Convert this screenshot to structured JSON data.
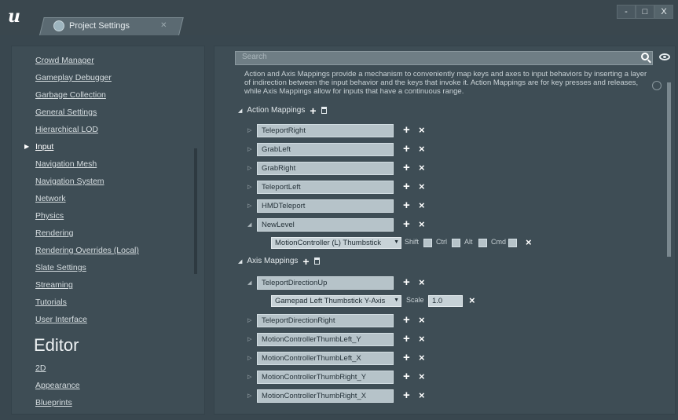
{
  "window": {
    "tab_title": "Project Settings",
    "controls": {
      "minimize": "-",
      "maximize": "□",
      "close": "X"
    }
  },
  "sidebar": {
    "items": [
      {
        "label": "Crowd Manager"
      },
      {
        "label": "Gameplay Debugger"
      },
      {
        "label": "Garbage Collection"
      },
      {
        "label": "General Settings"
      },
      {
        "label": "Hierarchical LOD"
      },
      {
        "label": "Input",
        "active": true
      },
      {
        "label": "Navigation Mesh"
      },
      {
        "label": "Navigation System"
      },
      {
        "label": "Network"
      },
      {
        "label": "Physics"
      },
      {
        "label": "Rendering"
      },
      {
        "label": "Rendering Overrides (Local)"
      },
      {
        "label": "Slate Settings"
      },
      {
        "label": "Streaming"
      },
      {
        "label": "Tutorials"
      },
      {
        "label": "User Interface"
      }
    ],
    "editor_heading": "Editor",
    "editor_items": [
      {
        "label": "2D"
      },
      {
        "label": "Appearance"
      },
      {
        "label": "Blueprints"
      }
    ]
  },
  "main": {
    "search_placeholder": "Search",
    "description": "Action and Axis Mappings provide a mechanism to conveniently map keys and axes to input behaviors by inserting a layer of indirection between the input behavior and the keys that invoke it. Action Mappings are for key presses and releases, while Axis Mappings allow for inputs that have a continuous range.",
    "action_section_label": "Action Mappings",
    "axis_section_label": "Axis Mappings",
    "action_mappings": [
      {
        "name": "TeleportRight"
      },
      {
        "name": "GrabLeft"
      },
      {
        "name": "GrabRight"
      },
      {
        "name": "TeleportLeft"
      },
      {
        "name": "HMDTeleport"
      },
      {
        "name": "NewLevel",
        "expanded": true
      }
    ],
    "action_key": {
      "key": "MotionController (L) Thumbstick",
      "shift": "Shift",
      "ctrl": "Ctrl",
      "alt": "Alt",
      "cmd": "Cmd"
    },
    "axis_mappings": [
      {
        "name": "TeleportDirectionUp",
        "expanded": true
      },
      {
        "name": "TeleportDirectionRight"
      },
      {
        "name": "MotionControllerThumbLeft_Y"
      },
      {
        "name": "MotionControllerThumbLeft_X"
      },
      {
        "name": "MotionControllerThumbRight_Y"
      },
      {
        "name": "MotionControllerThumbRight_X"
      }
    ],
    "axis_key": {
      "key": "Gamepad Left Thumbstick Y-Axis",
      "scale_label": "Scale",
      "scale_value": "1.0"
    },
    "glyphs": {
      "plus": "+",
      "remove": "×"
    }
  }
}
